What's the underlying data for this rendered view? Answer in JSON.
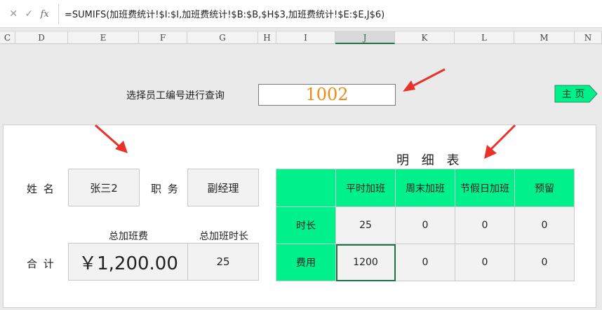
{
  "formula_bar": {
    "cancel_icon": "✕",
    "confirm_icon": "✓",
    "fx_label": "fx",
    "formula": "=SUMIFS(加班费统计!$I:$I,加班费统计!$B:$B,$H$3,加班费统计!$E:$E,J$6)"
  },
  "columns": [
    "C",
    "D",
    "E",
    "F",
    "G",
    "H",
    "I",
    "J",
    "K",
    "L",
    "M",
    "N"
  ],
  "active_column": "J",
  "query": {
    "label": "选择员工编号进行查询",
    "value": "1002"
  },
  "home_button": {
    "label": "主 页"
  },
  "employee": {
    "name_label": "姓  名",
    "name_value": "张三2",
    "position_label": "职 务",
    "position_value": "副经理"
  },
  "totals": {
    "row_label": "合  计",
    "total_fee_label": "总加班费",
    "total_fee_value": "￥1,200.00",
    "total_hours_label": "总加班时长",
    "total_hours_value": "25"
  },
  "detail": {
    "title": "明 细 表",
    "headers": [
      "",
      "平时加班",
      "周末加班",
      "节假日加班",
      "预留"
    ],
    "rows": [
      [
        "时长",
        "25",
        "0",
        "0",
        "0"
      ],
      [
        "费用",
        "1200",
        "0",
        "0",
        "0"
      ]
    ]
  },
  "colors": {
    "accent_green": "#00f08c",
    "arrow_red": "#e8322a",
    "query_value": "#ef8a17",
    "selection_border": "#1e7145"
  }
}
